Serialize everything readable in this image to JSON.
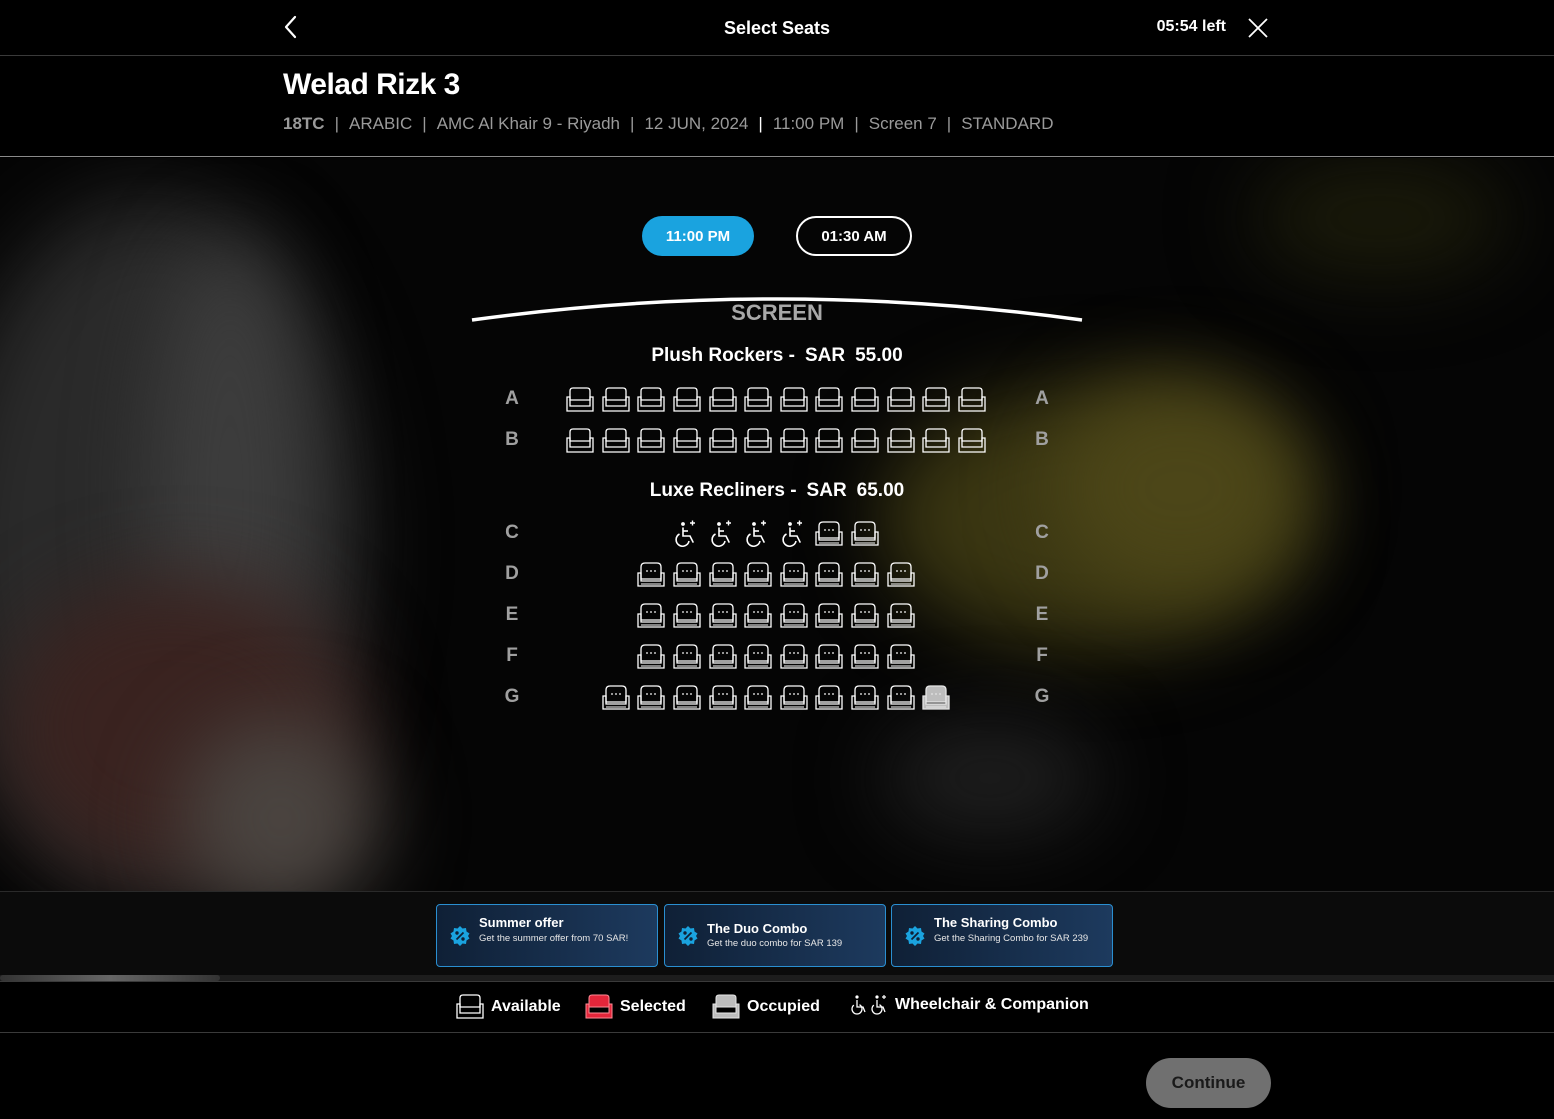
{
  "header": {
    "title": "Select Seats",
    "timer": "05:54 left"
  },
  "movie": {
    "title": "Welad Rizk 3",
    "meta": [
      "18TC",
      "ARABIC",
      "AMC Al Khair 9 - Riyadh",
      "12 JUN, 2024",
      "11:00 PM",
      "Screen 7",
      "STANDARD"
    ]
  },
  "showtimes": [
    {
      "label": "11:00 PM",
      "selected": true
    },
    {
      "label": "01:30 AM",
      "selected": false
    }
  ],
  "screen_label": "SCREEN",
  "sections": [
    {
      "name": "Plush Rockers -",
      "currency": "SAR",
      "price": "55.00",
      "seat_style": "rocker",
      "rows": [
        {
          "label": "A",
          "seats": [
            "available",
            "available",
            "available",
            "available",
            "available",
            "available",
            "available",
            "available",
            "available",
            "available",
            "available",
            "available"
          ]
        },
        {
          "label": "B",
          "seats": [
            "available",
            "available",
            "available",
            "available",
            "available",
            "available",
            "available",
            "available",
            "available",
            "available",
            "available",
            "available"
          ]
        }
      ]
    },
    {
      "name": "Luxe Recliners -",
      "currency": "SAR",
      "price": "65.00",
      "seat_style": "recliner",
      "rows": [
        {
          "label": "C",
          "seats": [
            "wheelchair",
            "wheelchair",
            "wheelchair",
            "wheelchair",
            "available",
            "available"
          ]
        },
        {
          "label": "D",
          "seats": [
            "available",
            "available",
            "available",
            "available",
            "available",
            "available",
            "available",
            "available"
          ]
        },
        {
          "label": "E",
          "seats": [
            "available",
            "available",
            "available",
            "available",
            "available",
            "available",
            "available",
            "available"
          ]
        },
        {
          "label": "F",
          "seats": [
            "available",
            "available",
            "available",
            "available",
            "available",
            "available",
            "available",
            "available"
          ]
        },
        {
          "label": "G",
          "seats": [
            "available",
            "available",
            "available",
            "available",
            "available",
            "available",
            "available",
            "available",
            "available",
            "occupied"
          ]
        }
      ]
    }
  ],
  "offers": [
    {
      "title": "Summer offer",
      "desc": "Get the summer offer from 70 SAR!",
      "icon": "percent-icon"
    },
    {
      "title": "The Duo Combo",
      "desc": "Get the duo combo for SAR 139",
      "icon": "percent-icon"
    },
    {
      "title": "The Sharing Combo",
      "desc": "Get the Sharing Combo for SAR 239",
      "icon": "percent-icon"
    }
  ],
  "legend": {
    "available": "Available",
    "selected": "Selected",
    "occupied": "Occupied",
    "wheelchair": "Wheelchair & Companion"
  },
  "continue_label": "Continue",
  "colors": {
    "accent": "#1aa3df",
    "selected_seat": "#e3263a",
    "occupied_seat": "#bdbdbd",
    "continue_disabled": "#707070",
    "offer_border": "#2a8fd1"
  }
}
